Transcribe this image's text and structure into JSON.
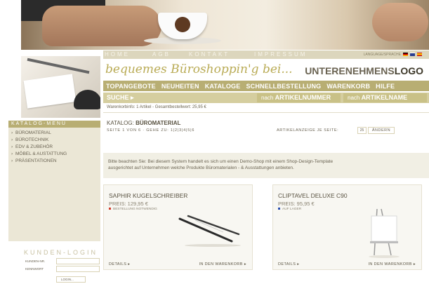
{
  "header": {
    "nav": [
      "HOME",
      "AGB",
      "KONTAKT",
      "IMPRESSUM"
    ],
    "language_label": "LANGUAGE/SPRACHE",
    "flags": [
      "de-flag-icon",
      "uk-flag-icon",
      "es-flag-icon"
    ],
    "slogan": "bequemes Büroshoppin'g bei...",
    "logo_part1": "UNTERENEHMENS",
    "logo_part2": "LOGO"
  },
  "main_menu": [
    "TOPANGEBOTE",
    "NEUHEITEN",
    "KATALOGE",
    "SCHNELLBESTELLUNG",
    "WARENKORB",
    "HILFE"
  ],
  "search": {
    "label": "SUCHE",
    "by_number_prefix": "nach",
    "by_number": "ARTIKELNUMMER",
    "by_name_prefix": "nach",
    "by_name": "ARTIKELNAME"
  },
  "cart_info": "Warenkorbinfo: 1 Artikel - Gesamtbestellwert: 25,95 €",
  "sidebar": {
    "catalog_heading": "KATALOG-MENÜ",
    "catalog_items": [
      "BÜROMATERIAL",
      "BÜROTECHNIK",
      "EDV & ZUBEHÖR",
      "MÖBEL & AUSTATTUNG",
      "PRÄSENTATIONEN"
    ],
    "login_heading": "KUNDEN-LOGIN",
    "login_fields": [
      "KUNDEN-NR.",
      "KENNWORT"
    ],
    "login_button": "LOGIN..."
  },
  "content": {
    "category_label": "KATALOG:",
    "category_name": "BÜROMATERIAL",
    "paging": "SEITE 1 VON 6 · GEHE ZU: 1|2|3|4|5|6",
    "per_page_label": "ARTIKELANZEIGE JE SEITE:",
    "per_page_value": "25",
    "per_page_button": "ÄNDERN",
    "notice_line1": "Bitte beachten Sie: Bei diesem System handelt es sich um einen Demo-Shop mit einem Shop-Design-Template",
    "notice_line2": "ausgerichtet auf Unternehmen welche Produkte Büromaterialen - & Ausstattungen anbieten."
  },
  "products": [
    {
      "name": "SAPHIR KUGELSCHREIBER",
      "price": "PREIS: 129,95 €",
      "status": "BESTELLUNG NOTWENDIG",
      "status_color": "#d23b2b",
      "details": "DETAILS",
      "cart": "IN DEN WARENKORB"
    },
    {
      "name": "CLIPTAVEL DELUXE C90",
      "price": "PREIS: 95,95 €",
      "status": "AUF LAGER",
      "status_color": "#2b4fb0",
      "details": "DETAILS",
      "cart": "IN DEN WARENKORB"
    }
  ],
  "colors": {
    "accent": "#b8ae73",
    "accent_light": "#d5ce9f",
    "sidebar_bg": "#ebe7d6"
  }
}
